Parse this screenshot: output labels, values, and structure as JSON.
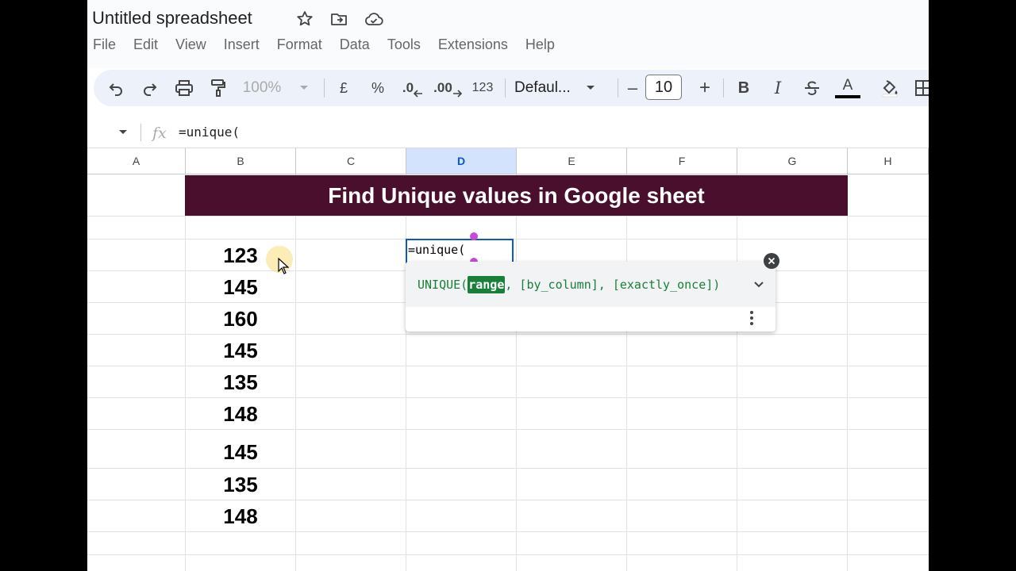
{
  "document": {
    "title": "Untitled spreadsheet"
  },
  "menu": [
    "File",
    "Edit",
    "View",
    "Insert",
    "Format",
    "Data",
    "Tools",
    "Extensions",
    "Help"
  ],
  "toolbar": {
    "zoom": "100%",
    "currency": "£",
    "percent": "%",
    "decrease_decimal": ".0",
    "increase_decimal": ".00",
    "number_format": "123",
    "font": "Defaul...",
    "font_size": "10",
    "minus": "–",
    "plus": "+",
    "bold": "B",
    "italic": "I",
    "text_color": "A"
  },
  "formula_bar": {
    "fx": "fx",
    "content": "=unique("
  },
  "columns": [
    "A",
    "B",
    "C",
    "D",
    "E",
    "F",
    "G",
    "H"
  ],
  "selected_column": "D",
  "banner": {
    "text": "Find Unique values in Google sheet",
    "bg_color": "#4a0f2c"
  },
  "values_b": [
    "123",
    "145",
    "160",
    "145",
    "135",
    "148",
    "145",
    "135",
    "148"
  ],
  "active_cell": {
    "content": "=unique("
  },
  "tooltip": {
    "fn": "UNIQUE(",
    "arg_highlight": "range",
    "rest": ", [by_column], [exactly_once])"
  },
  "colors": {
    "accent": "#0b57d0",
    "formula_green": "#188038"
  }
}
